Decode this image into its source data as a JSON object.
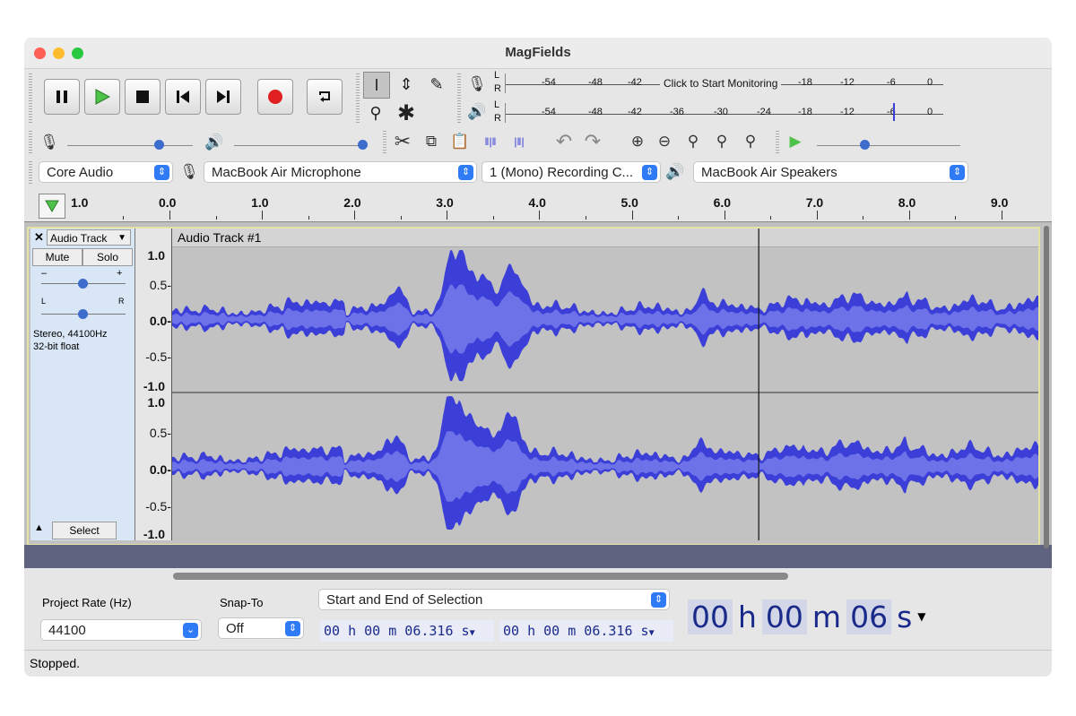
{
  "window": {
    "title": "MagFields"
  },
  "meters": {
    "record_ticks": [
      "-54",
      "-48",
      "-42",
      "-18",
      "-12",
      "-6",
      "0"
    ],
    "record_hint": "Click to Start Monitoring",
    "play_ticks": [
      "-54",
      "-48",
      "-42",
      "-36",
      "-30",
      "-24",
      "-18",
      "-12",
      "-6",
      "0"
    ],
    "channel_L": "L",
    "channel_R": "R"
  },
  "devices": {
    "host": "Core Audio",
    "recording_device": "MacBook Air Microphone",
    "recording_channels": "1 (Mono) Recording C...",
    "playback_device": "MacBook Air Speakers"
  },
  "ruler": {
    "start_label": "1.0",
    "labels": [
      "0.0",
      "1.0",
      "2.0",
      "3.0",
      "4.0",
      "5.0",
      "6.0",
      "7.0",
      "8.0",
      "9.0"
    ]
  },
  "track": {
    "menu_label": "Audio Track",
    "name": "Audio Track #1",
    "mute_label": "Mute",
    "solo_label": "Solo",
    "gain_minus": "–",
    "gain_plus": "+",
    "pan_left": "L",
    "pan_right": "R",
    "info_line1": "Stereo, 44100Hz",
    "info_line2": "32-bit float",
    "select_label": "Select",
    "scale_top": [
      "1.0",
      "0.5-",
      "0.0-",
      "-0.5-",
      "-1.0"
    ],
    "scale_bottom": [
      "1.0",
      "0.5-",
      "0.0-",
      "-0.5-",
      "-1.0"
    ],
    "cursor_seconds": 6.316
  },
  "bottom": {
    "project_rate_label": "Project Rate (Hz)",
    "project_rate_value": "44100",
    "snap_label": "Snap-To",
    "snap_value": "Off",
    "selection_mode": "Start and End of Selection",
    "sel_start": "00 h 00 m 06.316 s",
    "sel_end": "00 h 00 m 06.316 s",
    "big_time_h": "00",
    "big_time_m": "00",
    "big_time_s": "06",
    "unit_h": "h",
    "unit_m": "m",
    "unit_s": "s"
  },
  "status": {
    "text": "Stopped."
  },
  "colors": {
    "waveform": "#3b3fd8",
    "waveform_rms": "#6d72e8",
    "track_bg": "#c2c2c2",
    "accent": "#2f7bf5"
  }
}
